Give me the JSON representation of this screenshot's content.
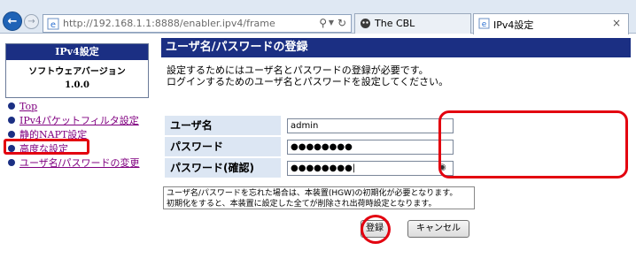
{
  "browser": {
    "url": "http://192.168.1.1:8888/enabler.ipv4/frame",
    "tabs": [
      {
        "label": "The CBL"
      },
      {
        "label": "IPv4設定"
      }
    ]
  },
  "sidebar": {
    "info_title": "IPv4設定",
    "info_subtitle": "ソフトウェアバージョン",
    "info_version": "1.0.0",
    "nav": [
      {
        "label": "Top"
      },
      {
        "label": "IPv4パケットフィルタ設定"
      },
      {
        "label": "静的NAPT設定"
      },
      {
        "label": "高度な設定"
      },
      {
        "label": "ユーザ名/パスワードの変更"
      }
    ]
  },
  "main": {
    "title": "ユーザ名/パスワードの登録",
    "desc_line1": "設定するためにはユーザ名とパスワードの登録が必要です。",
    "desc_line2": "ログインするためのユーザ名とパスワードを設定してください。",
    "fields": {
      "username_label": "ユーザ名",
      "username_value": "admin",
      "password_label": "パスワード",
      "password_value": "●●●●●●●●",
      "confirm_label": "パスワード(確認)",
      "confirm_value": "●●●●●●●●|"
    },
    "note_line1": "ユーザ名/パスワードを忘れた場合は、本装置(HGW)の初期化が必要となります。",
    "note_line2": "初期化をすると、本装置に設定した全てが削除され出荷時設定となります。",
    "register_label": "登録",
    "cancel_label": "キャンセル"
  },
  "icons": {
    "back": "back-arrow-icon",
    "forward": "forward-arrow-icon",
    "page": "ie-page-icon",
    "search": "search-icon",
    "refresh": "refresh-icon",
    "close": "close-icon",
    "reveal": "reveal-password-icon"
  },
  "colors": {
    "header_bg": "#1b2f83",
    "label_bg": "#dce6f3",
    "highlight": "#e3000f",
    "visited_link": "#800080"
  }
}
